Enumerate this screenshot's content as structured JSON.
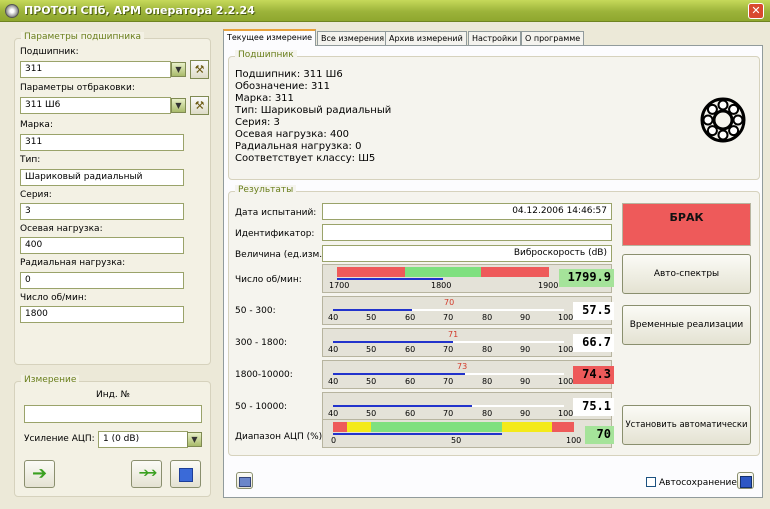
{
  "window": {
    "title": "ПРОТОН СПб, АРМ оператора 2.2.24"
  },
  "left": {
    "params_group_label": "Параметры подшипника",
    "bearing_label": "Подшипник:",
    "bearing_value": "311",
    "reject_label": "Параметры отбраковки:",
    "reject_value": "311 Ш6",
    "mark_label": "Марка:",
    "mark_value": "311",
    "type_label": "Тип:",
    "type_value": "Шариковый радиальный",
    "series_label": "Серия:",
    "series_value": "3",
    "axial_label": "Осевая нагрузка:",
    "axial_value": "400",
    "radial_label": "Радиальная нагрузка:",
    "radial_value": "0",
    "rpm_label": "Число об/мин:",
    "rpm_value": "1800",
    "measure_group_label": "Измерение",
    "ind_label": "Инд. №",
    "ind_value": "",
    "gain_label": "Усиление АЦП:",
    "gain_value": "1 (0 dB)"
  },
  "tabs": [
    "Текущее измерение",
    "Все измерения",
    "Архив измерений",
    "Настройки",
    "О программе"
  ],
  "bearing_info": {
    "group_label": "Подшипник",
    "lines": [
      "Подшипник: 311 Ш6",
      "Обозначение: 311",
      "Марка: 311",
      "Тип: Шариковый радиальный",
      "Серия: 3",
      "Осевая нагрузка: 400",
      "Радиальная нагрузка: 0",
      "Соответствует классу: Ш5"
    ]
  },
  "results": {
    "group_label": "Результаты",
    "date_label": "Дата испытаний:",
    "date_value": "04.12.2006 14:46:57",
    "id_label": "Идентификатор:",
    "id_value": "",
    "quantity_label": "Величина (ед.изм.):",
    "quantity_value": "Виброскорость (dB)",
    "rpm": {
      "label": "Число об/мин:",
      "ticks": [
        "1700",
        "1800",
        "1900"
      ],
      "value": "1799.9",
      "fraction": 0.5
    },
    "bands": [
      {
        "label": "50 - 300:",
        "value": "57.5",
        "marker": "70",
        "level": 0.34,
        "marker_pos": 0.5,
        "status": "ok"
      },
      {
        "label": "300 - 1800:",
        "value": "66.7",
        "marker": "71",
        "level": 0.52,
        "marker_pos": 0.52,
        "status": "ok"
      },
      {
        "label": "1800-10000:",
        "value": "74.3",
        "marker": "73",
        "level": 0.57,
        "marker_pos": 0.56,
        "status": "bad"
      },
      {
        "label": "50 - 10000:",
        "value": "75.1",
        "marker": "",
        "level": 0.6,
        "marker_pos": 0,
        "status": "ok"
      }
    ],
    "band_ticks": [
      "40",
      "50",
      "60",
      "70",
      "80",
      "90",
      "100"
    ],
    "adc": {
      "label": "Диапазон АЦП (%):",
      "ticks": [
        "0",
        "50",
        "100"
      ],
      "value": "70",
      "level": 0.7
    },
    "verdict": "БРАК",
    "buttons": {
      "spectra": "Авто-спектры",
      "time": "Временные реализации",
      "auto": "Установить автоматически"
    },
    "autosave_label": "Автосохранение"
  },
  "colors": {
    "verdict_bg": "#ee5a5a",
    "ok_green": "#9fe08f",
    "bad_red": "#ee5a5a",
    "accent": "#9cb33a"
  }
}
